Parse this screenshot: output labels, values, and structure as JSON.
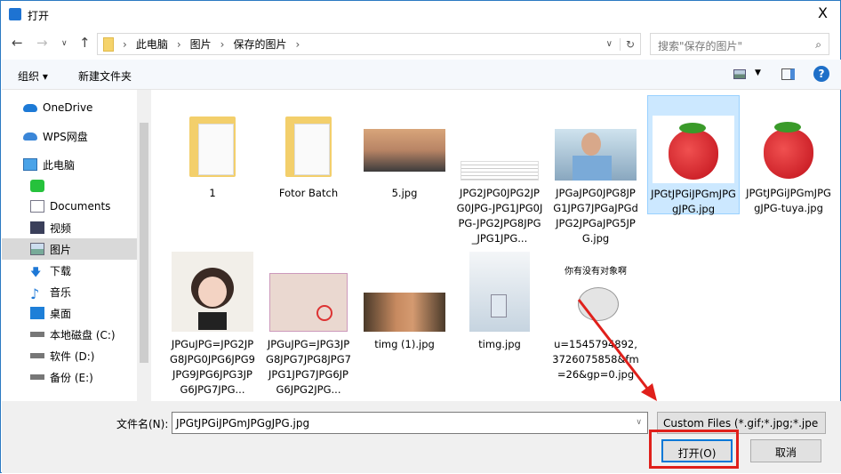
{
  "window": {
    "title": "打开",
    "close": "X"
  },
  "address": {
    "crumbs": [
      "此电脑",
      "图片",
      "保存的图片"
    ],
    "search_placeholder": "搜索\"保存的图片\""
  },
  "toolbar": {
    "organize": "组织 ▾",
    "new_folder": "新建文件夹"
  },
  "sidebar": {
    "items": [
      {
        "label": "OneDrive",
        "icon": "cloud-icon"
      },
      {
        "label": "WPS网盘",
        "icon": "wps-cloud-icon"
      },
      {
        "label": "此电脑",
        "icon": "computer-icon"
      },
      {
        "label": "",
        "icon": "app-icon"
      },
      {
        "label": "Documents",
        "icon": "document-icon"
      },
      {
        "label": "视频",
        "icon": "video-icon"
      },
      {
        "label": "图片",
        "icon": "pictures-icon"
      },
      {
        "label": "下载",
        "icon": "download-icon"
      },
      {
        "label": "音乐",
        "icon": "music-icon"
      },
      {
        "label": "桌面",
        "icon": "desktop-icon"
      },
      {
        "label": "本地磁盘 (C:)",
        "icon": "drive-icon"
      },
      {
        "label": "软件 (D:)",
        "icon": "drive-icon"
      },
      {
        "label": "备份 (E:)",
        "icon": "drive-icon"
      }
    ]
  },
  "files": [
    {
      "name": "1",
      "type": "folder"
    },
    {
      "name": "Fotor Batch",
      "type": "folder"
    },
    {
      "name": "5.jpg",
      "type": "sunset"
    },
    {
      "name": "JPG2JPG0JPG2JPG0JPG-JPG1JPG0JPG-JPG2JPG8JPG_JPG1JPG...",
      "type": "doc"
    },
    {
      "name": "JPGaJPG0JPG8JPG1JPG7JPGaJPGdJPG2JPGaJPG5JPG.jpg",
      "type": "boy"
    },
    {
      "name": "JPGtJPGiJPGmJPGgJPG.jpg",
      "type": "strawberry",
      "selected": true
    },
    {
      "name": "JPGtJPGiJPGmJPGgJPG-tuya.jpg",
      "type": "strawberry"
    },
    {
      "name": "JPGuJPG=JPG2JPG8JPG0JPG6JPG9JPG9JPG6JPG3JPG6JPG7JPG...",
      "type": "girl"
    },
    {
      "name": "JPGuJPG=JPG3JPG8JPG7JPG8JPG7JPG1JPG7JPG6JPG6JPG2JPG...",
      "type": "cert"
    },
    {
      "name": "timg (1).jpg",
      "type": "kid"
    },
    {
      "name": "timg.jpg",
      "type": "bottle"
    },
    {
      "name": "u=1545794892,3726075858&fm=26&gp=0.jpg",
      "type": "cartoon"
    }
  ],
  "cartoon_text": "你有没有对象啊",
  "footer": {
    "filename_label": "文件名(N):",
    "filename": "JPGtJPGiJPGmJPGgJPG.jpg",
    "filter": "Custom Files (*.gif;*.jpg;*.jpe",
    "open": "打开(O)",
    "cancel": "取消"
  },
  "colors": {
    "accent": "#0078d7",
    "annotation": "#e0201b",
    "selection": "#cce8ff"
  }
}
